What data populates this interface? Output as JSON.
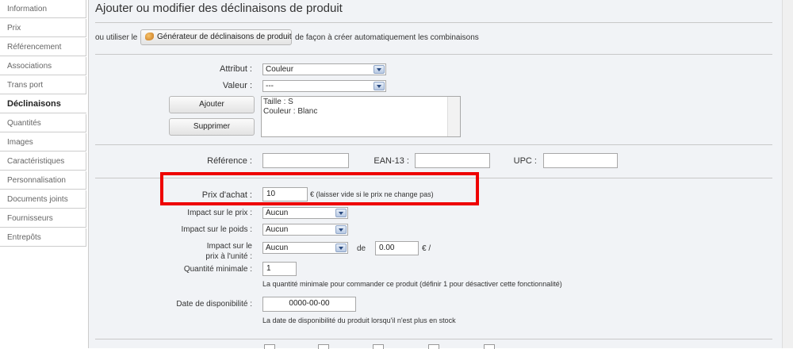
{
  "sidebar": {
    "items": [
      {
        "label": "Information",
        "active": false
      },
      {
        "label": "Prix",
        "active": false
      },
      {
        "label": "Référencement",
        "active": false
      },
      {
        "label": "Associations",
        "active": false
      },
      {
        "label": "Trans port",
        "active": false
      },
      {
        "label": "Déclinaisons",
        "active": true
      },
      {
        "label": "Quantités",
        "active": false
      },
      {
        "label": "Images",
        "active": false
      },
      {
        "label": "Caractéristiques",
        "active": false
      },
      {
        "label": "Personnalisation",
        "active": false
      },
      {
        "label": "Documents joints",
        "active": false
      },
      {
        "label": "Fournisseurs",
        "active": false
      },
      {
        "label": "Entrepôts",
        "active": false
      }
    ]
  },
  "main": {
    "title": "Ajouter ou modifier des déclinaisons de produit",
    "generator": {
      "prefix": "ou utiliser le",
      "button_label": "Générateur de déclinaisons de produit",
      "suffix": "de façon à créer automatiquement les combinaisons",
      "icon": "generator-icon"
    },
    "attribute": {
      "label": "Attribut :",
      "value": "Couleur"
    },
    "value": {
      "label": "Valeur :",
      "value": "---"
    },
    "add_button": "Ajouter",
    "remove_button": "Supprimer",
    "combination_list": [
      "Taille : S",
      "Couleur : Blanc"
    ],
    "reference": {
      "label": "Référence :",
      "value": ""
    },
    "ean13": {
      "label": "EAN-13 :",
      "value": ""
    },
    "upc": {
      "label": "UPC :",
      "value": ""
    },
    "purchase_price": {
      "label": "Prix d'achat :",
      "value": "10",
      "hint": "€ (laisser vide si le prix ne change pas)"
    },
    "price_impact": {
      "label": "Impact sur le prix :",
      "value": "Aucun"
    },
    "weight_impact": {
      "label": "Impact sur le poids :",
      "value": "Aucun"
    },
    "unit_price_impact": {
      "label_line1": "Impact sur le",
      "label_line2": "prix à l'unité :",
      "value": "Aucun",
      "de": "de",
      "amount": "0.00",
      "unit": "€ /"
    },
    "min_quantity": {
      "label": "Quantité minimale :",
      "value": "1",
      "hint": "La quantité minimale pour commander ce produit (définir 1 pour désactiver cette fonctionnalité)"
    },
    "availability_date": {
      "label": "Date de disponibilité :",
      "value": "0000-00-00",
      "hint": "La date de disponibilité du produit lorsqu'il n'est plus en stock"
    }
  },
  "colors": {
    "highlight": "#ee0000",
    "panel_bg": "#f1f3f6"
  }
}
